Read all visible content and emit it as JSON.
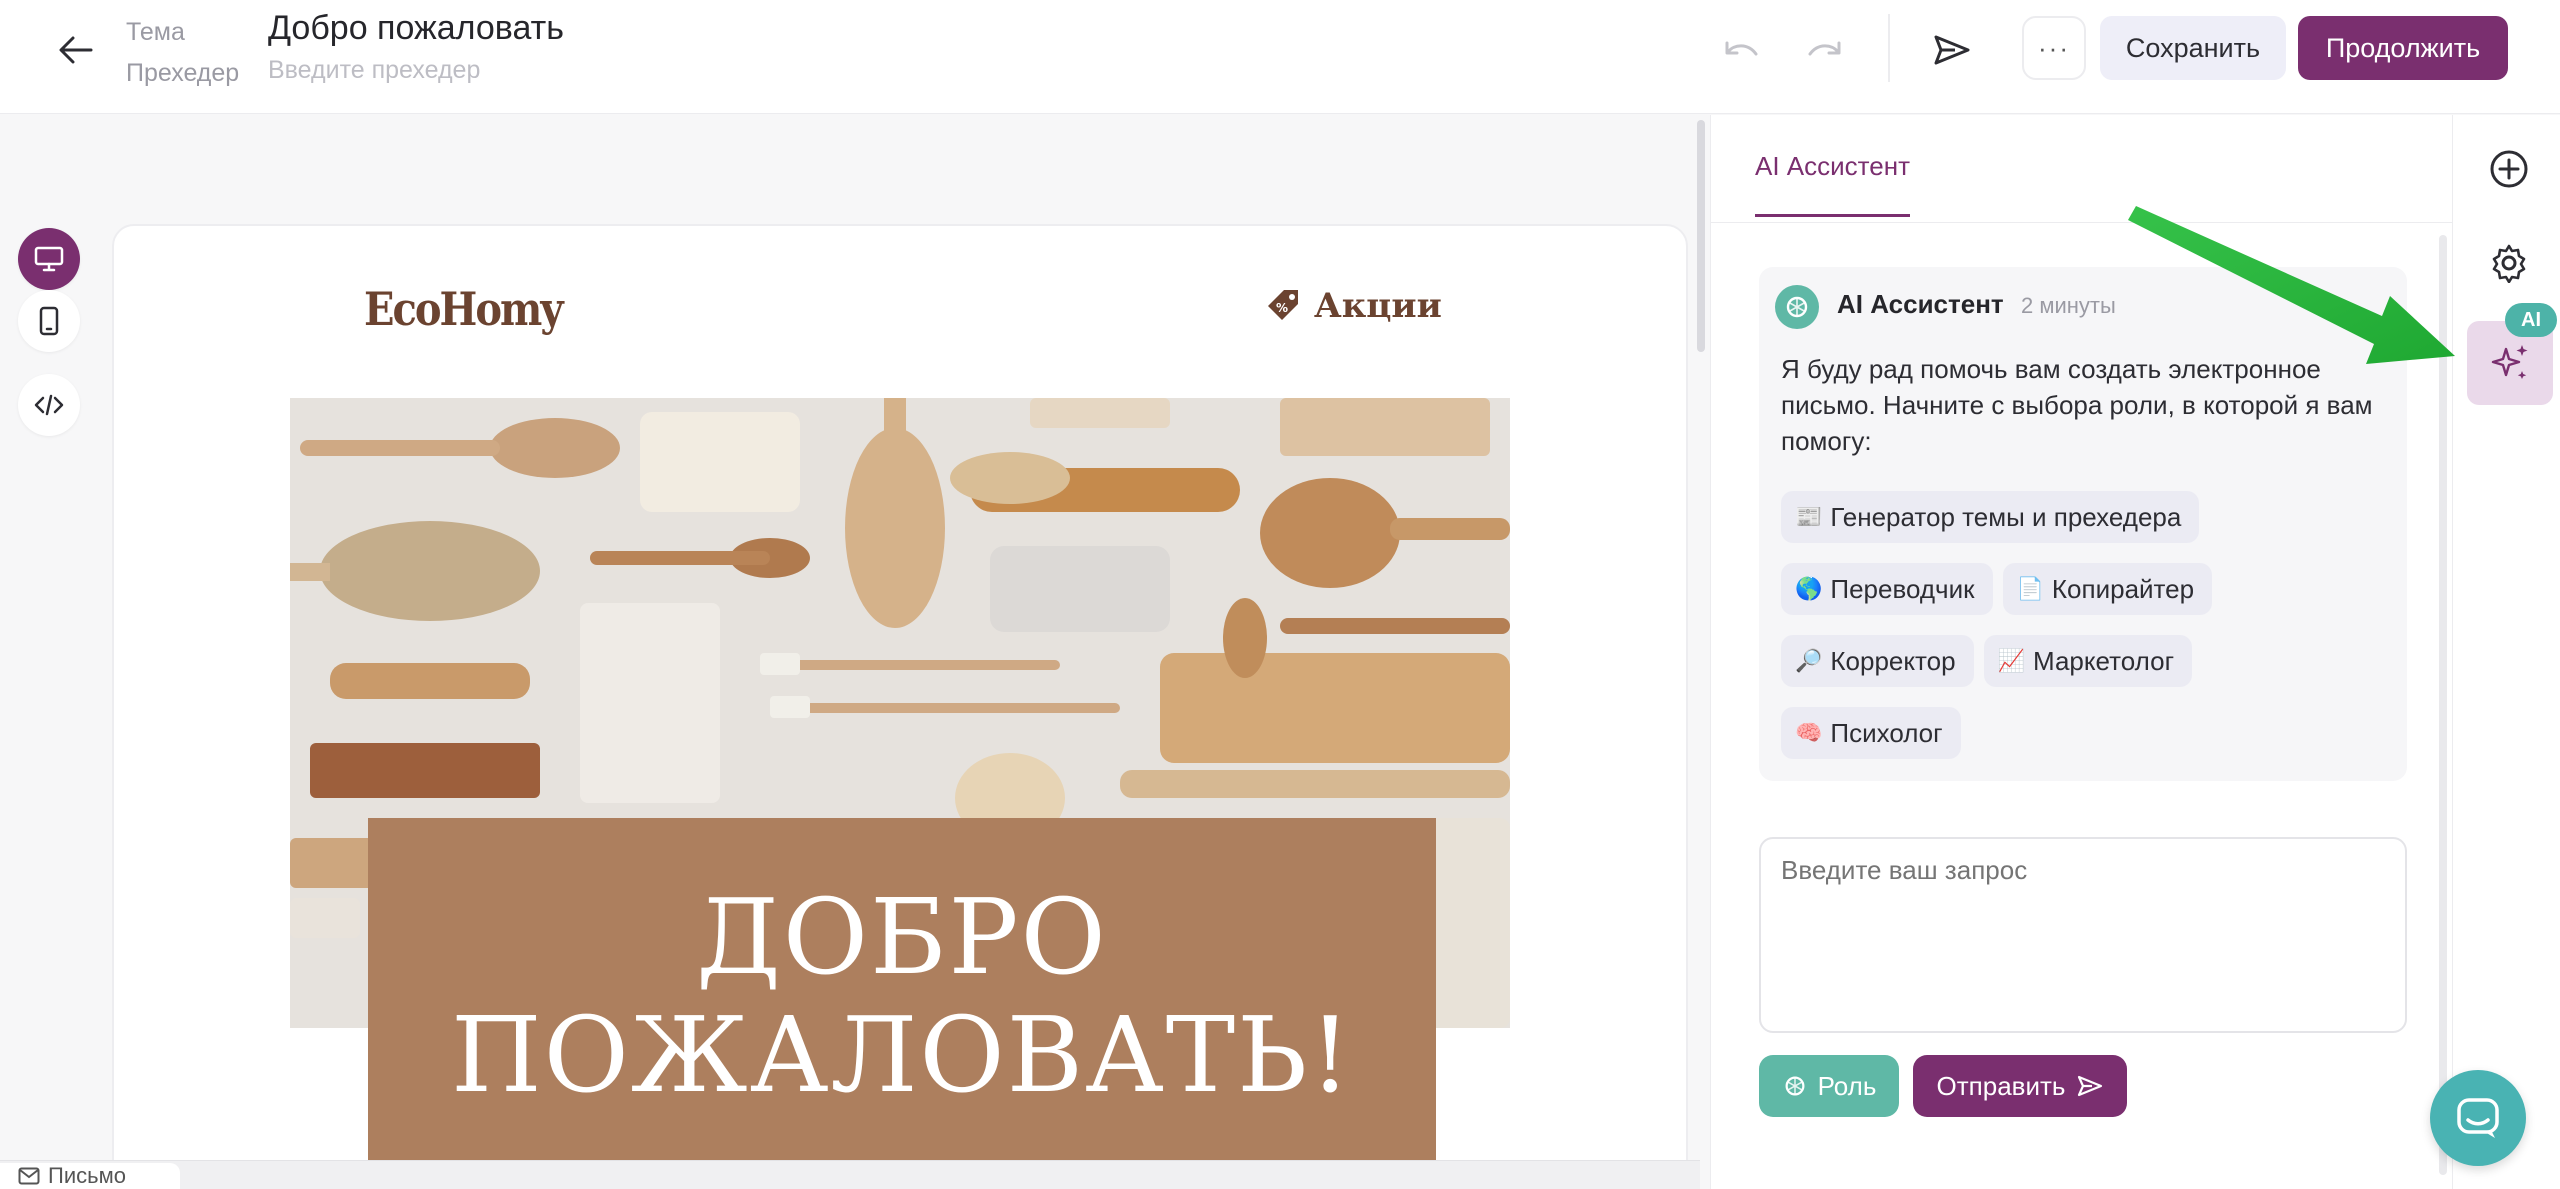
{
  "header": {
    "subject_label": "Тема",
    "preheader_label": "Прехедер",
    "subject_value": "Добро пожаловать",
    "preheader_placeholder": "Введите прехедер",
    "more_label": "···",
    "save_label": "Сохранить",
    "continue_label": "Продолжить"
  },
  "email": {
    "logo_text": "EcoHomy",
    "promo_link": "Акции",
    "welcome_line1": "ДОБРО",
    "welcome_line2": "ПОЖАЛОВАТЬ!"
  },
  "ai_panel": {
    "tab_label": "AI Ассистент",
    "message": {
      "author": "AI Ассистент",
      "time": "2 минуты",
      "text": "Я буду рад помочь вам создать электронное письмо. Начните с выбора роли, в которой я вам помогу:"
    },
    "roles": [
      {
        "emoji": "📰",
        "label": "Генератор темы и прехедера"
      },
      {
        "emoji": "🌎",
        "label": "Переводчик"
      },
      {
        "emoji": "📄",
        "label": "Копирайтер"
      },
      {
        "emoji": "🔎",
        "label": "Корректор"
      },
      {
        "emoji": "📈",
        "label": "Маркетолог"
      },
      {
        "emoji": "🧠",
        "label": "Психолог"
      }
    ],
    "input_placeholder": "Введите ваш запрос",
    "role_button": "Роль",
    "send_button": "Отправить"
  },
  "rail": {
    "ai_badge": "AI"
  },
  "bottom_tab": {
    "label": "Письмо"
  },
  "colors": {
    "brand": "#7a2f6f",
    "teal": "#5fb8a6",
    "hero_box": "#ad7f5e",
    "logo": "#6b4330",
    "arrow": "#2dbb3c"
  }
}
